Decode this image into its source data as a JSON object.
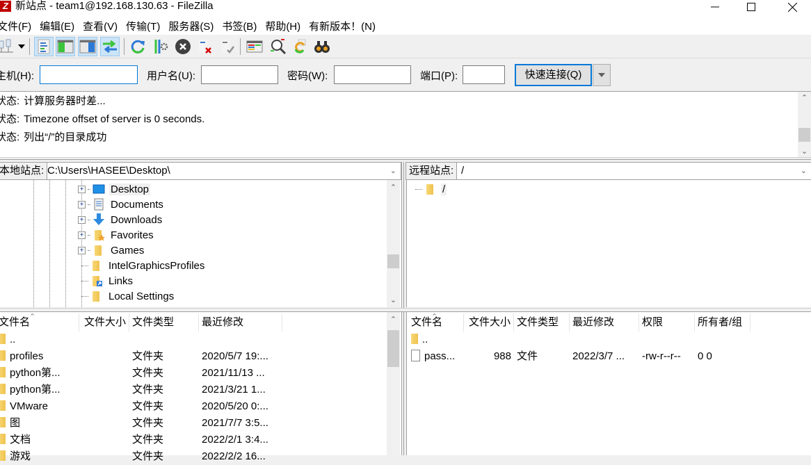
{
  "window": {
    "title": "新站点 - team1@192.168.130.63 - FileZilla",
    "app_icon": "Z",
    "controls": {
      "minimize": "minimize-icon",
      "maximize": "maximize-icon",
      "close": "close-icon"
    }
  },
  "menu": [
    "文件(F)",
    "编辑(E)",
    "查看(V)",
    "传输(T)",
    "服务器(S)",
    "书签(B)",
    "帮助(H)",
    "有新版本！(N)"
  ],
  "toolbar": {
    "buttons": [
      {
        "name": "site-manager",
        "icon": "site-manager-icon",
        "active": false
      },
      {
        "name": "site-manager-dropdown",
        "icon": "dropdown-arrow-icon",
        "active": false
      },
      {
        "name": "toggle-message-log",
        "icon": "message-log-icon",
        "active": true
      },
      {
        "name": "toggle-local-tree",
        "icon": "local-tree-icon",
        "active": true
      },
      {
        "name": "toggle-remote-tree",
        "icon": "remote-tree-icon",
        "active": true
      },
      {
        "name": "toggle-transfer-queue",
        "icon": "transfer-queue-icon",
        "active": true
      },
      {
        "name": "refresh",
        "icon": "refresh-icon",
        "active": false
      },
      {
        "name": "process-queue",
        "icon": "process-queue-icon",
        "active": false
      },
      {
        "name": "cancel-operation",
        "icon": "cancel-icon",
        "active": false
      },
      {
        "name": "disconnect",
        "icon": "disconnect-icon",
        "active": false
      },
      {
        "name": "reconnect",
        "icon": "reconnect-icon",
        "active": false
      },
      {
        "name": "directory-listing-filters",
        "icon": "filter-icon",
        "active": false
      },
      {
        "name": "directory-comparison",
        "icon": "compare-icon",
        "active": false
      },
      {
        "name": "synchronized-browsing",
        "icon": "sync-browse-icon",
        "active": false
      },
      {
        "name": "search-remote-files",
        "icon": "binoculars-icon",
        "active": false
      }
    ]
  },
  "quickconnect": {
    "host_label": "主机(H):",
    "host_value": "",
    "user_label": "用户名(U):",
    "user_value": "",
    "pass_label": "密码(W):",
    "pass_value": "",
    "port_label": "端口(P):",
    "port_value": "",
    "connect_label": "快速连接(Q)"
  },
  "log": [
    {
      "label": "状态:",
      "text": "计算服务器时差..."
    },
    {
      "label": "状态:",
      "text": "Timezone offset of server is 0 seconds."
    },
    {
      "label": "状态:",
      "text": "列出“/”的目录成功"
    }
  ],
  "local": {
    "site_label": "本地站点:",
    "path": "C:\\Users\\HASEE\\Desktop\\",
    "tree": [
      {
        "label": "Desktop",
        "icon": "desktop-icon",
        "expandable": true,
        "selected": true
      },
      {
        "label": "Documents",
        "icon": "documents-icon",
        "expandable": true
      },
      {
        "label": "Downloads",
        "icon": "downloads-icon",
        "expandable": true
      },
      {
        "label": "Favorites",
        "icon": "favorites-folder-icon",
        "expandable": true
      },
      {
        "label": "Games",
        "icon": "folder-icon",
        "expandable": true
      },
      {
        "label": "IntelGraphicsProfiles",
        "icon": "folder-icon",
        "expandable": false
      },
      {
        "label": "Links",
        "icon": "links-folder-icon",
        "expandable": false
      },
      {
        "label": "Local Settings",
        "icon": "folder-icon",
        "expandable": false
      }
    ],
    "columns": [
      "文件名",
      "文件大小",
      "文件类型",
      "最近修改"
    ],
    "files": [
      {
        "name": "..",
        "size": "",
        "type": "",
        "modified": ""
      },
      {
        "name": "profiles",
        "size": "",
        "type": "文件夹",
        "modified": "2020/5/7 19:..."
      },
      {
        "name": "python第...",
        "size": "",
        "type": "文件夹",
        "modified": "2021/11/13 ..."
      },
      {
        "name": "python第...",
        "size": "",
        "type": "文件夹",
        "modified": "2021/3/21 1..."
      },
      {
        "name": "VMware",
        "size": "",
        "type": "文件夹",
        "modified": "2020/5/20 0:..."
      },
      {
        "name": "图",
        "size": "",
        "type": "文件夹",
        "modified": "2021/7/7 3:5..."
      },
      {
        "name": "文档",
        "size": "",
        "type": "文件夹",
        "modified": "2022/2/1 3:4..."
      },
      {
        "name": "游戏",
        "size": "",
        "type": "文件夹",
        "modified": "2022/2/2 16..."
      }
    ]
  },
  "remote": {
    "site_label": "远程站点:",
    "path": "/",
    "tree": [
      {
        "label": "/",
        "icon": "folder-icon"
      }
    ],
    "columns": [
      "文件名",
      "文件大小",
      "文件类型",
      "最近修改",
      "权限",
      "所有者/组"
    ],
    "files": [
      {
        "name": "..",
        "size": "",
        "type": "",
        "modified": "",
        "perms": "",
        "owner": "",
        "kind": "folder"
      },
      {
        "name": "pass...",
        "size": "988",
        "type": "文件",
        "modified": "2022/3/7 ...",
        "perms": "-rw-r--r--",
        "owner": "0 0",
        "kind": "file"
      }
    ]
  }
}
